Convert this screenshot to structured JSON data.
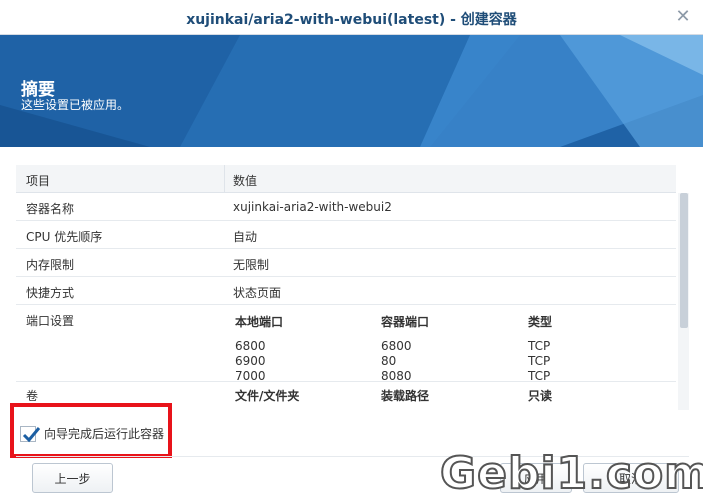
{
  "window": {
    "title": "xujinkai/aria2-with-webui(latest) - 创建容器"
  },
  "banner": {
    "title": "摘要",
    "subtitle": "这些设置已被应用。"
  },
  "table": {
    "headers": [
      "项目",
      "数值"
    ],
    "rows": [
      {
        "label": "容器名称",
        "value": "xujinkai-aria2-with-webui2"
      },
      {
        "label": "CPU 优先顺序",
        "value": "自动"
      },
      {
        "label": "内存限制",
        "value": "无限制"
      },
      {
        "label": "快捷方式",
        "value": "状态页面"
      }
    ],
    "ports": {
      "label": "端口设置",
      "headers": [
        "本地端口",
        "容器端口",
        "类型"
      ],
      "local": [
        "6800",
        "6900",
        "7000"
      ],
      "container": [
        "6800",
        "80",
        "8080"
      ],
      "type": [
        "TCP",
        "TCP",
        "TCP"
      ]
    },
    "volume": {
      "label": "卷",
      "headers": [
        "文件/文件夹",
        "装载路径",
        "只读"
      ]
    }
  },
  "checkbox": {
    "label": "向导完成后运行此容器",
    "checked": true
  },
  "buttons": {
    "prev": "上一步",
    "apply": "应用",
    "cancel": "取消"
  },
  "watermark": "Gebi1.com",
  "colors": {
    "banner": "#1f62a6",
    "title": "#1f4d78",
    "highlight": "#e8131a"
  }
}
